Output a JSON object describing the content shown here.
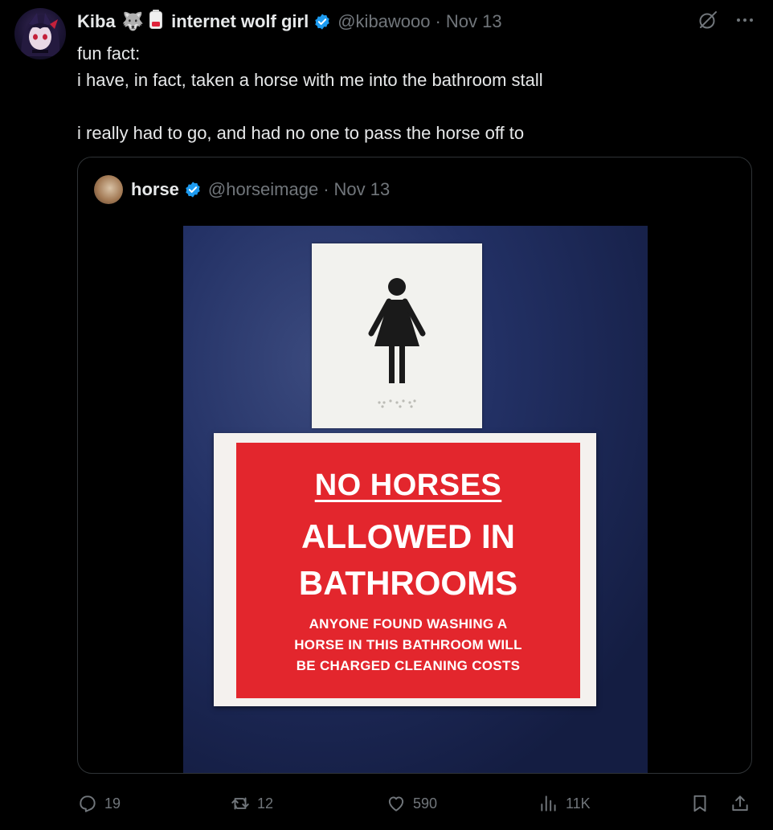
{
  "tweet": {
    "display_name": "Kiba",
    "emoji_wolf": "🐺",
    "emoji_battery": "🪫",
    "display_name_suffix": "internet wolf girl",
    "handle": "@kibawooo",
    "separator": "·",
    "timestamp": "Nov 13",
    "text_lines": [
      "fun fact:",
      "i have, in fact, taken a horse with me into the bathroom stall",
      "",
      "i really had to go, and had no one to pass the horse off to"
    ]
  },
  "quote": {
    "display_name": "horse",
    "handle": "@horseimage",
    "separator": "·",
    "timestamp": "Nov 13",
    "image_sign": {
      "title": "NO HORSES",
      "line2": "ALLOWED IN",
      "line3": "BATHROOMS",
      "small_lines": [
        "ANYONE FOUND WASHING A",
        "HORSE IN THIS BATHROOM WILL",
        "BE CHARGED CLEANING COSTS"
      ]
    }
  },
  "actions": {
    "replies": "19",
    "reposts": "12",
    "likes": "590",
    "views": "11K"
  },
  "icons": {
    "verified": "verified-badge-icon",
    "grok": "grok-icon",
    "more": "more-icon",
    "reply": "reply-icon",
    "repost": "repost-icon",
    "like": "heart-icon",
    "views": "views-icon",
    "bookmark": "bookmark-icon",
    "share": "share-icon"
  },
  "colors": {
    "background": "#000000",
    "text": "#e7e9ea",
    "muted": "#71767b",
    "verified": "#1d9bf0",
    "sign_red": "#e3262d",
    "door_blue": "#1e2a55"
  }
}
